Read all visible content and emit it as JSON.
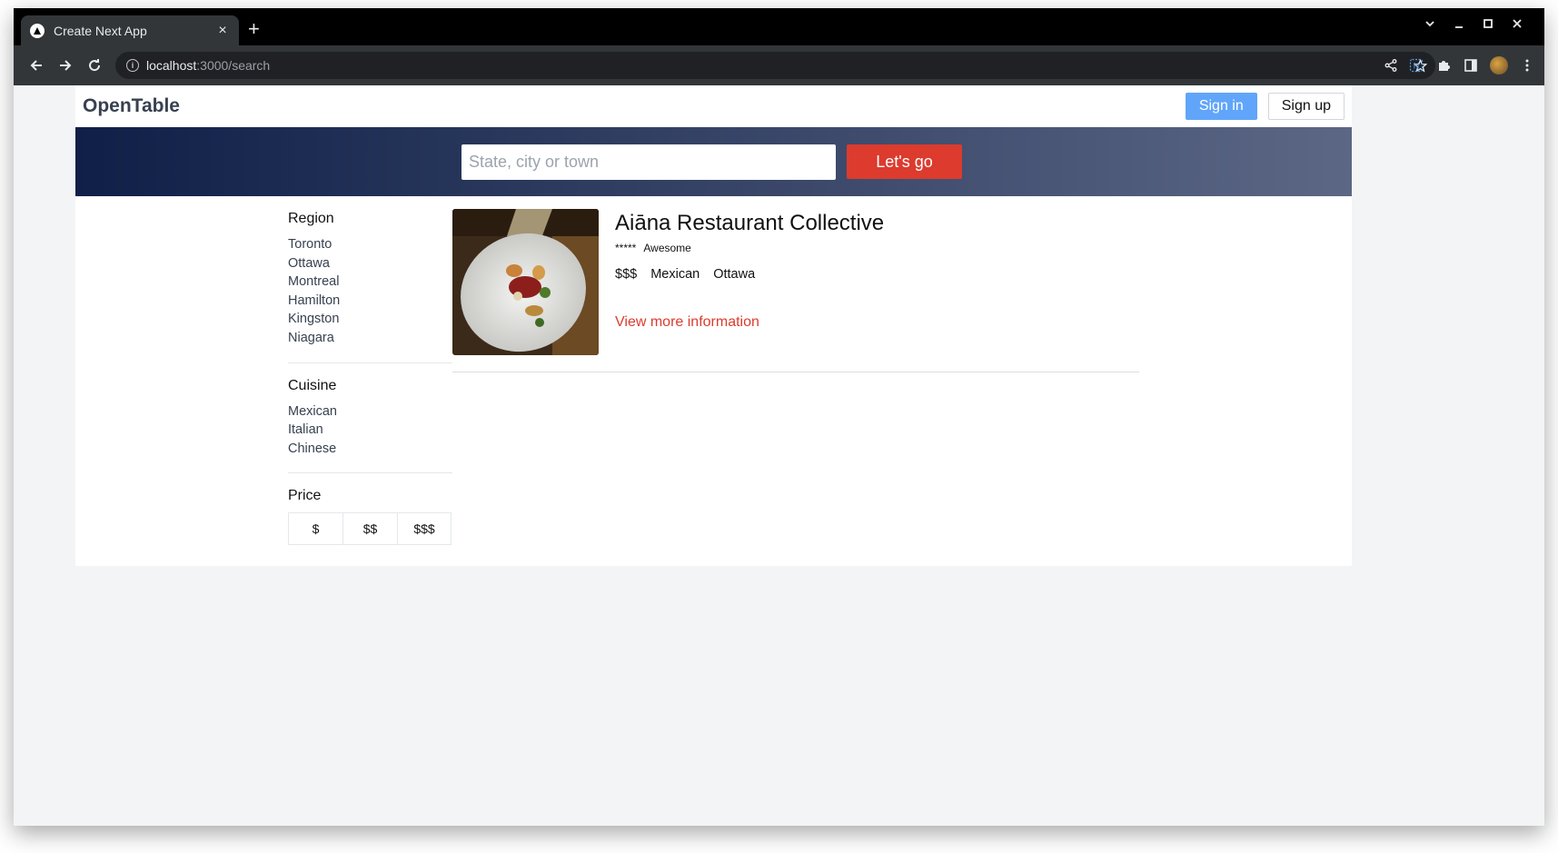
{
  "browser": {
    "tab_title": "Create Next App",
    "tab_close": "×",
    "new_tab": "+",
    "url_host": "localhost",
    "url_rest": ":3000/search"
  },
  "site": {
    "brand": "OpenTable",
    "signin_label": "Sign in",
    "signup_label": "Sign up"
  },
  "search": {
    "placeholder": "State, city or town",
    "button_label": "Let's go"
  },
  "filters": {
    "region": {
      "title": "Region",
      "items": [
        "Toronto",
        "Ottawa",
        "Montreal",
        "Hamilton",
        "Kingston",
        "Niagara"
      ]
    },
    "cuisine": {
      "title": "Cuisine",
      "items": [
        "Mexican",
        "Italian",
        "Chinese"
      ]
    },
    "price": {
      "title": "Price",
      "options": [
        "$",
        "$$",
        "$$$"
      ]
    }
  },
  "results": [
    {
      "name": "Aiāna Restaurant Collective",
      "stars": "*****",
      "rating_label": "Awesome",
      "price": "$$$",
      "cuisine": "Mexican",
      "location": "Ottawa",
      "link_label": "View more information"
    }
  ]
}
